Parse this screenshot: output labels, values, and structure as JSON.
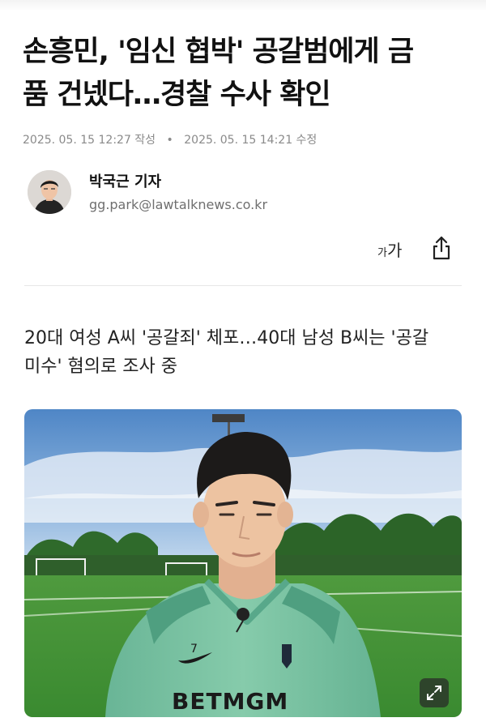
{
  "article": {
    "headline_line1": "손흥민, '임신 협박' 공갈범에게 금",
    "headline_line2": "품 건넸다…경찰 수사 확인",
    "published": "2025. 05. 15 12:27 작성",
    "updated": "2025. 05. 15 14:21 수정",
    "separator": "•",
    "subtitle_line1": "20대 여성 A씨 '공갈죄' 체포…40대 남성 B씨는 '공갈",
    "subtitle_line2": "미수' 혐의로 조사 중"
  },
  "author": {
    "name": "박국근 기자",
    "email": "gg.park@lawtalknews.co.kr"
  },
  "toolbar": {
    "font_small": "가",
    "font_large": "가",
    "share_icon": "share-icon"
  },
  "photo": {
    "jersey_number": "7",
    "sponsor_text": "BETMGM",
    "expand_icon": "expand-icon",
    "colors": {
      "sky": "#5f8fc4",
      "grass": "#3f8c34",
      "jersey": "#7fc4a6"
    }
  }
}
